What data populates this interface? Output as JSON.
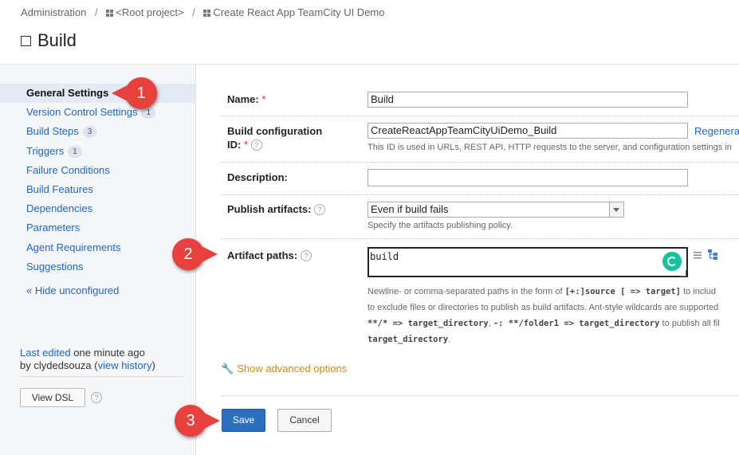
{
  "breadcrumb": {
    "admin": "Administration",
    "sep": "/",
    "root": "<Root project>",
    "project": "Create React App TeamCity UI Demo"
  },
  "page_title": "Build",
  "sidebar": {
    "items": [
      {
        "label": "General Settings",
        "count": ""
      },
      {
        "label": "Version Control Settings",
        "count": "1"
      },
      {
        "label": "Build Steps",
        "count": "3"
      },
      {
        "label": "Triggers",
        "count": "1"
      },
      {
        "label": "Failure Conditions",
        "count": ""
      },
      {
        "label": "Build Features",
        "count": ""
      },
      {
        "label": "Dependencies",
        "count": ""
      },
      {
        "label": "Parameters",
        "count": ""
      },
      {
        "label": "Agent Requirements",
        "count": ""
      },
      {
        "label": "Suggestions",
        "count": ""
      }
    ],
    "hide_unconfigured": "« Hide unconfigured",
    "last_edited_link": "Last edited",
    "last_edited_time": "one minute ago",
    "by": "by clydedsouza",
    "view_history": "view history",
    "view_dsl": "View DSL"
  },
  "form": {
    "name_label": "Name:",
    "name_value": "Build",
    "id_label_line1": "Build configuration",
    "id_label_line2": "ID:",
    "id_value": "CreateReactAppTeamCityUiDemo_Build",
    "regenerate": "Regenerat",
    "id_note": "This ID is used in URLs, REST API, HTTP requests to the server, and configuration settings in",
    "description_label": "Description:",
    "description_value": "",
    "publish_label": "Publish artifacts:",
    "publish_value": "Even if build fails",
    "publish_note": "Specify the artifacts publishing policy.",
    "artifact_label": "Artifact paths:",
    "artifact_value": "build",
    "artifact_note_line1_a": "Newline- or comma-separated paths in the form of ",
    "artifact_note_line1_code": "[+:]source [ => target]",
    "artifact_note_line1_b": " to includ",
    "artifact_note_line2": "to exclude files or directories to publish as build artifacts. Ant-style wildcards are supported",
    "artifact_note_line3_code1": "**/* => target_directory",
    "artifact_note_line3_sep": ", ",
    "artifact_note_line3_code2": "-: **/folder1 => target_directory",
    "artifact_note_line3_b": " to publish all fil",
    "artifact_note_line4_code": "target_directory",
    "artifact_note_line4_b": ".",
    "required_mark": "*",
    "help_mark": "?"
  },
  "advanced": "Show advanced options",
  "buttons": {
    "save": "Save",
    "cancel": "Cancel"
  },
  "callouts": [
    "1",
    "2",
    "3"
  ],
  "colors": {
    "accent": "#2166c0",
    "callout": "#e8403c",
    "save": "#2c6fbe",
    "advanced": "#d08a12"
  }
}
